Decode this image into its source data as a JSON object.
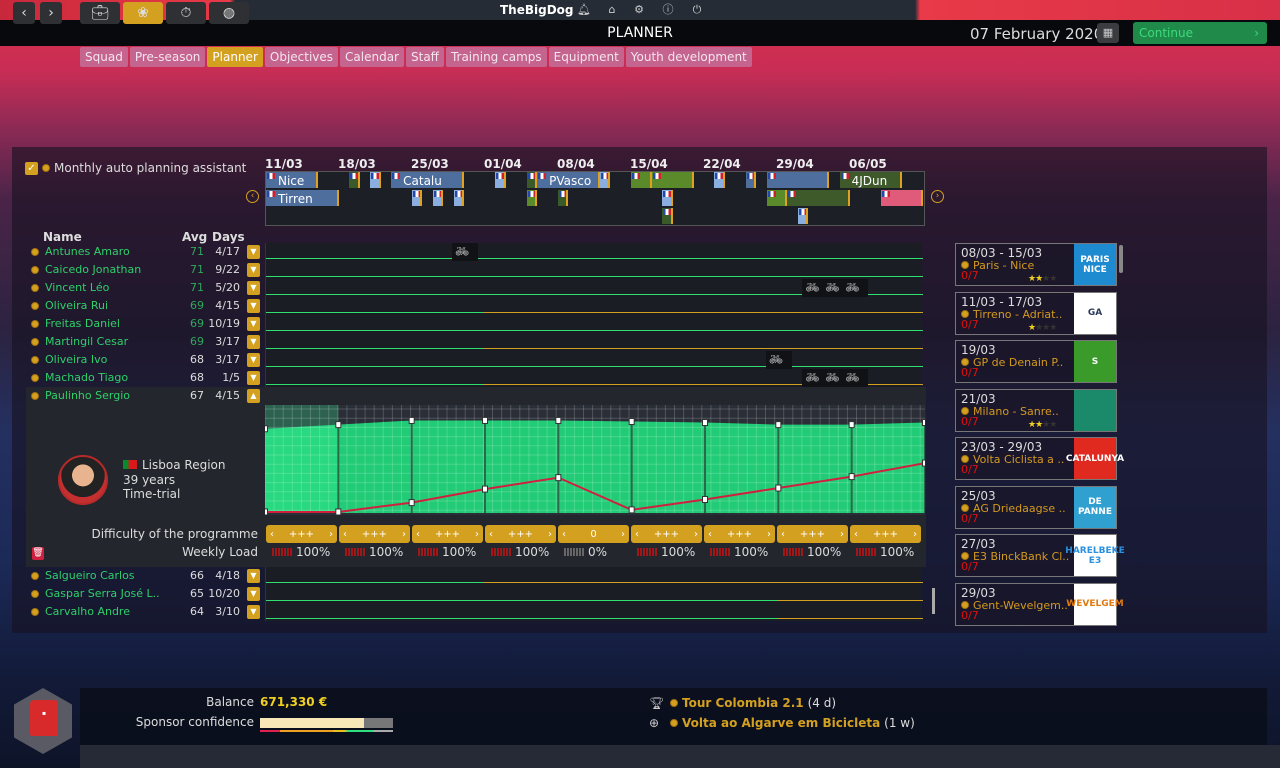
{
  "header": {
    "brand": "TheBigDog",
    "page_title": "PLANNER",
    "date": "07 February 2020",
    "continue_label": "Continue",
    "icons": [
      "bell-icon",
      "home-icon",
      "gear-icon",
      "info-icon",
      "power-icon"
    ]
  },
  "nav": {
    "icons": [
      "back-icon",
      "forward-icon",
      "briefcase-icon",
      "team-icon",
      "stopwatch-icon",
      "globe-icon"
    ],
    "active": "team-icon"
  },
  "tabs": [
    {
      "label": "Squad"
    },
    {
      "label": "Pre-season"
    },
    {
      "label": "Planner",
      "active": true
    },
    {
      "label": "Objectives"
    },
    {
      "label": "Calendar"
    },
    {
      "label": "Staff"
    },
    {
      "label": "Training camps"
    },
    {
      "label": "Equipment"
    },
    {
      "label": "Youth development"
    }
  ],
  "planner": {
    "auto_planning_label": "Monthly auto planning assistant",
    "auto_planning_checked": true,
    "timeline_dates": [
      "11/03",
      "18/03",
      "25/03",
      "01/04",
      "08/04",
      "15/04",
      "22/04",
      "29/04",
      "06/05"
    ],
    "timeline_events": [
      {
        "label": "Nice",
        "row": 0,
        "start": "11/03",
        "end": "15/03",
        "color": "#4e6e9e"
      },
      {
        "label": "",
        "row": 0,
        "start": "19/03",
        "end": "19/03",
        "color": "#3a5a2a"
      },
      {
        "label": "",
        "row": 0,
        "start": "21/03",
        "end": "21/03",
        "color": "#8aaee0"
      },
      {
        "label": "Catalu",
        "row": 0,
        "start": "23/03",
        "end": "29/03",
        "color": "#4e6e9e"
      },
      {
        "label": "",
        "row": 0,
        "start": "02/04",
        "end": "02/04",
        "color": "#8aaee0"
      },
      {
        "label": "",
        "row": 0,
        "start": "05/04",
        "end": "05/04",
        "color": "#3a5a2a"
      },
      {
        "label": "PVasco",
        "row": 0,
        "start": "06/04",
        "end": "11/04",
        "color": "#4e6e9e"
      },
      {
        "label": "",
        "row": 0,
        "start": "12/04",
        "end": "12/04",
        "color": "#8aaee0"
      },
      {
        "label": "",
        "row": 0,
        "start": "15/04",
        "end": "16/04",
        "color": "#5a8a2a"
      },
      {
        "label": "",
        "row": 0,
        "start": "17/04",
        "end": "20/04",
        "color": "#5a8a2a"
      },
      {
        "label": "",
        "row": 0,
        "start": "23/04",
        "end": "23/04",
        "color": "#8aaee0"
      },
      {
        "label": "",
        "row": 0,
        "start": "26/04",
        "end": "26/04",
        "color": "#4e6e9e"
      },
      {
        "label": "",
        "row": 0,
        "start": "28/04",
        "end": "03/05",
        "color": "#4e6e9e"
      },
      {
        "label": "4JDun",
        "row": 0,
        "start": "05/05",
        "end": "10/05",
        "color": "#3e5a2a"
      },
      {
        "label": "Tirren",
        "row": 1,
        "start": "11/03",
        "end": "17/03",
        "color": "#4e6e9e"
      },
      {
        "label": "",
        "row": 1,
        "start": "25/03",
        "end": "25/03",
        "color": "#8aaee0"
      },
      {
        "label": "",
        "row": 1,
        "start": "27/03",
        "end": "27/03",
        "color": "#8aaee0"
      },
      {
        "label": "",
        "row": 1,
        "start": "29/03",
        "end": "29/03",
        "color": "#8aaee0"
      },
      {
        "label": "",
        "row": 1,
        "start": "05/04",
        "end": "05/04",
        "color": "#5a8a2a"
      },
      {
        "label": "",
        "row": 1,
        "start": "08/04",
        "end": "08/04",
        "color": "#3a5a2a"
      },
      {
        "label": "",
        "row": 1,
        "start": "18/04",
        "end": "18/04",
        "color": "#8aaee0"
      },
      {
        "label": "",
        "row": 1,
        "start": "28/04",
        "end": "29/04",
        "color": "#5a8a2a"
      },
      {
        "label": "",
        "row": 1,
        "start": "30/04",
        "end": "05/05",
        "color": "#3e5a2a"
      },
      {
        "label": "",
        "row": 1,
        "start": "09/05",
        "end": "12/05",
        "color": "#e05a7a"
      },
      {
        "label": "",
        "row": 2,
        "start": "18/04",
        "end": "18/04",
        "color": "#3a5a2a"
      },
      {
        "label": "",
        "row": 2,
        "start": "01/05",
        "end": "01/05",
        "color": "#8aaee0"
      }
    ],
    "columns": {
      "name": "Name",
      "avg": "Avg",
      "days": "Days"
    },
    "riders": [
      {
        "name": "Antunes Amaro",
        "avg": "71",
        "days": "4/17",
        "avg_color": "#2fa85a",
        "bikes": [
          {
            "week": 3,
            "count": 1
          }
        ],
        "load_green": 1
      },
      {
        "name": "Caicedo Jonathan",
        "avg": "71",
        "days": "9/22",
        "avg_color": "#2fa85a",
        "bikes": [],
        "load_green": 1
      },
      {
        "name": "Vincent Léo",
        "avg": "71",
        "days": "5/20",
        "avg_color": "#2fa85a",
        "bikes": [
          {
            "week": 7.8,
            "count": 3
          }
        ],
        "load_green": 1
      },
      {
        "name": "Oliveira Rui",
        "avg": "69",
        "days": "4/15",
        "avg_color": "#2fa85a",
        "bikes": [],
        "load_green": 0.33
      },
      {
        "name": "Freitas Daniel",
        "avg": "69",
        "days": "10/19",
        "avg_color": "#2fa85a",
        "bikes": [],
        "load_green": 1
      },
      {
        "name": "Martingil Cesar",
        "avg": "69",
        "days": "3/17",
        "avg_color": "#2fa85a",
        "bikes": [],
        "load_green": 0.33
      },
      {
        "name": "Oliveira Ivo",
        "avg": "68",
        "days": "3/17",
        "avg_color": "#dddddd",
        "bikes": [
          {
            "week": 7.3,
            "count": 1
          }
        ],
        "load_green": 1
      },
      {
        "name": "Machado Tiago",
        "avg": "68",
        "days": "1/5",
        "avg_color": "#dddddd",
        "bikes": [
          {
            "week": 7.8,
            "count": 3
          }
        ],
        "load_green": 0.33
      },
      {
        "name": "Paulinho Sergio",
        "avg": "67",
        "days": "4/15",
        "avg_color": "#dddddd",
        "bikes": [],
        "load_green": 1,
        "selected": true
      }
    ],
    "riders_after": [
      {
        "name": "Salgueiro Carlos",
        "avg": "66",
        "days": "4/18",
        "avg_color": "#dddddd",
        "load_green": 0.33
      },
      {
        "name": "Gaspar Serra José L..",
        "avg": "65",
        "days": "10/20",
        "avg_color": "#dddddd",
        "load_green": 0.78
      },
      {
        "name": "Carvalho Andre",
        "avg": "64",
        "days": "3/10",
        "avg_color": "#dddddd",
        "load_green": 0.78
      }
    ],
    "selected_rider": {
      "region": "Lisboa Region",
      "age": "39 years",
      "specialty": "Time-trial",
      "form_curve": [
        0.81,
        0.85,
        0.89,
        0.89,
        0.89,
        0.88,
        0.87,
        0.85,
        0.85,
        0.87
      ],
      "fatigue_curve": [
        0.01,
        0.01,
        0.1,
        0.23,
        0.34,
        0.03,
        0.13,
        0.24,
        0.35,
        0.48
      ]
    },
    "difficulty_label": "Difficulty of the programme",
    "weekly_load_label": "Weekly Load",
    "weeks": [
      {
        "difficulty": "+++",
        "load": "100%"
      },
      {
        "difficulty": "+++",
        "load": "100%"
      },
      {
        "difficulty": "+++",
        "load": "100%"
      },
      {
        "difficulty": "+++",
        "load": "100%"
      },
      {
        "difficulty": "0",
        "load": "0%"
      },
      {
        "difficulty": "+++",
        "load": "100%"
      },
      {
        "difficulty": "+++",
        "load": "100%"
      },
      {
        "difficulty": "+++",
        "load": "100%"
      },
      {
        "difficulty": "+++",
        "load": "100%"
      }
    ]
  },
  "races": [
    {
      "dates": "08/03 - 15/03",
      "name": "Paris - Nice",
      "selected": "0/7",
      "stars": 1.5,
      "logo": "PARIS NICE",
      "logo_bg": "#1e8ad0",
      "logo_fg": "#ffffff"
    },
    {
      "dates": "11/03 - 17/03",
      "name": "Tirreno - Adriat..",
      "selected": "0/7",
      "stars": 1,
      "logo": "GA",
      "logo_bg": "#ffffff",
      "logo_fg": "#2a3a5a"
    },
    {
      "dates": "19/03",
      "name": "GP de Denain P..",
      "selected": "0/7",
      "stars": 0,
      "logo": "S",
      "logo_bg": "#3a9a2a",
      "logo_fg": "#ffffff"
    },
    {
      "dates": "21/03",
      "name": "Milano - Sanre..",
      "selected": "0/7",
      "stars": 2,
      "logo": "",
      "logo_bg": "#1a8a6a",
      "logo_fg": "#f0a020"
    },
    {
      "dates": "23/03 - 29/03",
      "name": "Volta Ciclista a ..",
      "selected": "0/7",
      "stars": 0,
      "logo": "CATALUNYA",
      "logo_bg": "#e02a20",
      "logo_fg": "#ffffff"
    },
    {
      "dates": "25/03",
      "name": "AG Driedaagse ..",
      "selected": "0/7",
      "stars": 0,
      "logo": "DE PANNE",
      "logo_bg": "#30a0d0",
      "logo_fg": "#ffffff"
    },
    {
      "dates": "27/03",
      "name": "E3 BinckBank Cl..",
      "selected": "0/7",
      "stars": 0,
      "logo": "HARELBEKE E3",
      "logo_bg": "#ffffff",
      "logo_fg": "#2a90e0"
    },
    {
      "dates": "29/03",
      "name": "Gent-Wevelgem..",
      "selected": "0/7",
      "stars": 0,
      "logo": "WEVELGEM",
      "logo_bg": "#ffffff",
      "logo_fg": "#e07a10"
    }
  ],
  "footer": {
    "balance_label": "Balance",
    "balance": "671,330 €",
    "sponsor_label": "Sponsor confidence",
    "sponsor_confidence": 0.78,
    "events": [
      {
        "icon": "trophy-icon",
        "name": "Tour Colombia 2.1",
        "when": "(4 d)"
      },
      {
        "icon": "bike-race-icon",
        "name": "Volta ao Algarve em Bicicleta",
        "when": "(1 w)"
      }
    ]
  }
}
